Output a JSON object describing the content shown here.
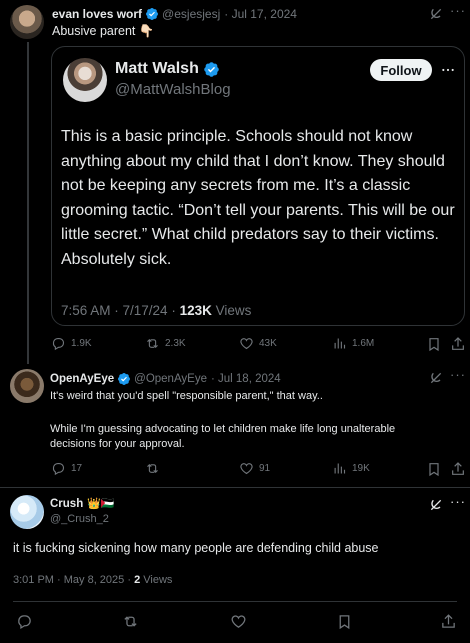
{
  "post1": {
    "name": "evan loves worf",
    "handle": "@esjesjesj",
    "date": "· Jul 17, 2024",
    "text": "Abusive parent 👇🏻",
    "quoted": {
      "name": "Matt Walsh",
      "handle": "@MattWalshBlog",
      "follow_label": "Follow",
      "text": "This is a basic principle. Schools should not know anything about my child that I don’t know. They should not be keeping any secrets from me. It’s a classic grooming tactic. “Don’t tell your parents. This will be our little secret.” What child predators say to their victims. Absolutely sick.",
      "time": "7:56 AM · 7/17/24 · ",
      "views_count": "123K",
      "views_label": " Views"
    },
    "actions": {
      "replies": "1.9K",
      "reposts": "2.3K",
      "likes": "43K",
      "views": "1.6M"
    }
  },
  "post2": {
    "name": "OpenAyEye",
    "handle": "@OpenAyEye",
    "date": "· Jul 18, 2024",
    "text1": "It's weird that you'd spell \"responsible parent,\" that way..",
    "text2": "While I'm guessing advocating to let children make life long unalterable decisions for your approval.",
    "actions": {
      "replies": "17",
      "reposts": "",
      "likes": "91",
      "views": "19K"
    }
  },
  "post3": {
    "name": "Crush",
    "badges": "👑🇵🇸",
    "handle": "@_Crush_2",
    "text": "it is fucking sickening how many people are defending child abuse",
    "time": "3:01 PM · May 8, 2025 · ",
    "views_count": "2",
    "views_label": " Views"
  },
  "colors": {
    "accent": "#1d9bf0",
    "muted": "#71767b",
    "text": "#e7e9ea",
    "border": "#2f3336"
  },
  "icons": [
    "grok-icon",
    "more-icon",
    "reply-icon",
    "repost-icon",
    "like-icon",
    "views-icon",
    "bookmark-icon",
    "share-icon",
    "verified-icon"
  ]
}
